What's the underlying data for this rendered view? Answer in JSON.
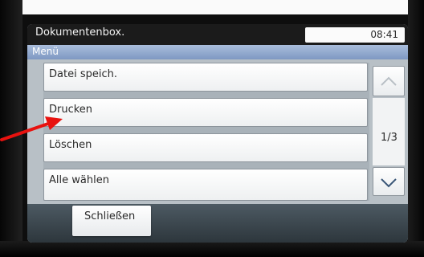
{
  "window": {
    "title": "Dokumentenbox.",
    "time": "08:41"
  },
  "menu": {
    "label": "Menü"
  },
  "list": {
    "items": [
      {
        "label": "Datei speich."
      },
      {
        "label": "Drucken"
      },
      {
        "label": "Löschen"
      },
      {
        "label": "Alle wählen"
      }
    ],
    "page": "1/3"
  },
  "footer": {
    "close_label": "Schließen"
  },
  "icons": {
    "scroll_up": "chevron-up-icon",
    "scroll_down": "chevron-down-icon",
    "pointer": "red-arrow-icon"
  },
  "colors": {
    "menubar": "#8fa8cf",
    "titlebar": "#1b1b1b",
    "arrow": "#e8120f"
  }
}
